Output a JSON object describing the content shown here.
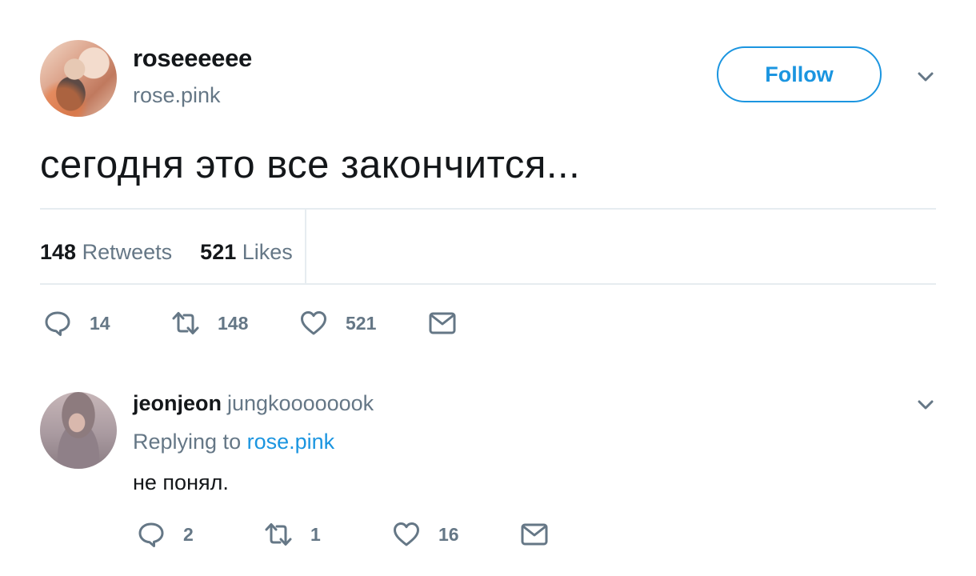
{
  "tweet": {
    "author_name": "roseeeeee",
    "author_handle": "rose.pink",
    "follow_label": "Follow",
    "text": "сегодня это все закончится...",
    "stats": {
      "retweets_count": "148",
      "retweets_label": "Retweets",
      "likes_count": "521",
      "likes_label": "Likes"
    },
    "actions": {
      "reply_count": "14",
      "retweet_count": "148",
      "like_count": "521"
    }
  },
  "reply": {
    "author_name": "jeonjeon",
    "author_handle": "jungkoooooook",
    "replying_prefix": "Replying to",
    "replying_to": "rose.pink",
    "text": "не понял.",
    "actions": {
      "reply_count": "2",
      "retweet_count": "1",
      "like_count": "16"
    }
  },
  "icons": {
    "chevron": "chevron-down-icon",
    "reply": "reply-icon",
    "retweet": "retweet-icon",
    "like": "heart-icon",
    "dm": "envelope-icon"
  },
  "colors": {
    "accent": "#1b95e0",
    "text_primary": "#14171a",
    "text_secondary": "#657786",
    "divider": "#e6ecf0"
  }
}
